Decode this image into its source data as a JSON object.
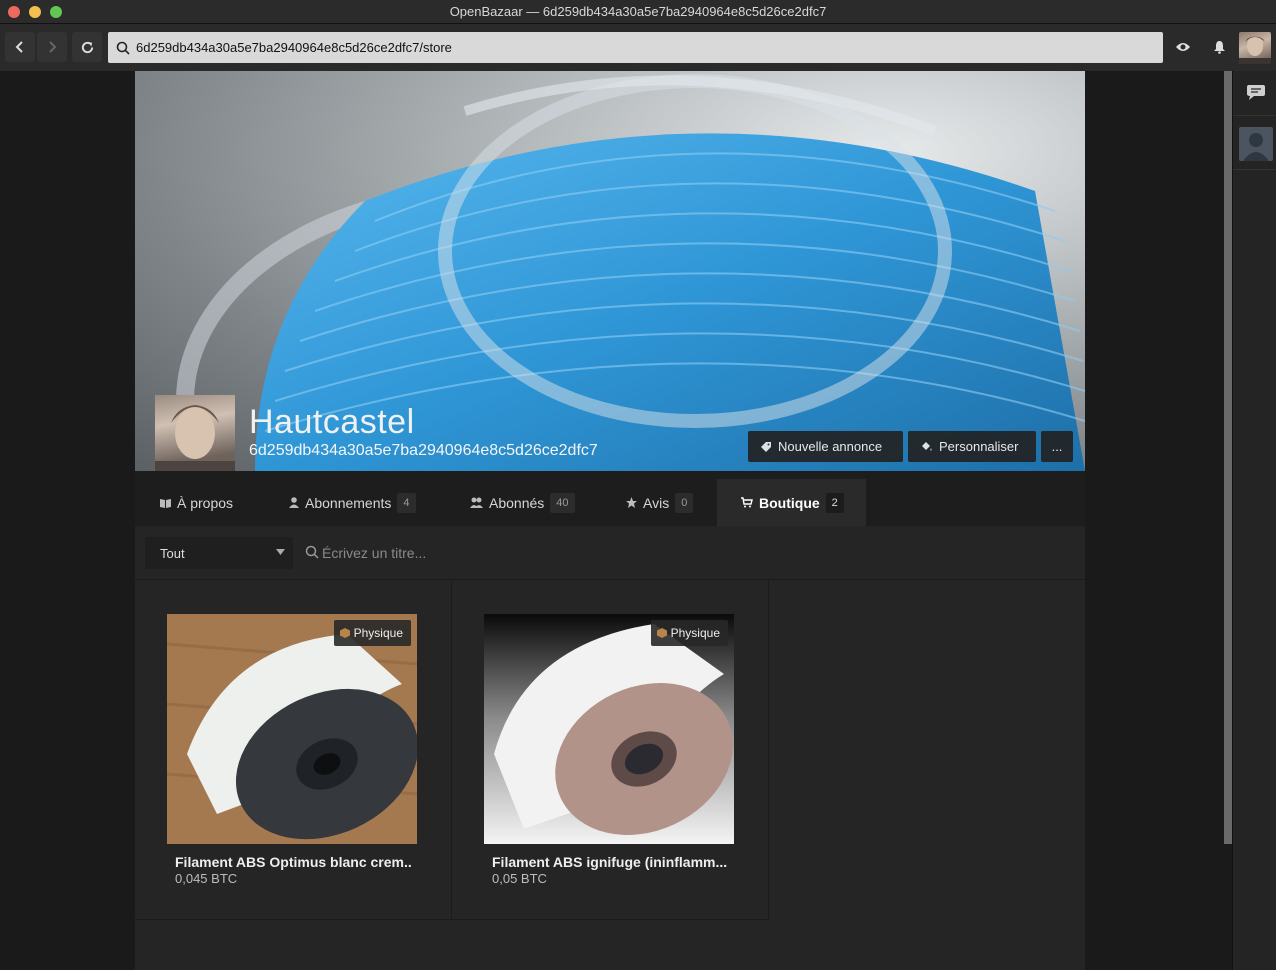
{
  "window": {
    "title": "OpenBazaar — 6d259db434a30a5e7ba2940964e8c5d26ce2dfc7"
  },
  "address": {
    "url": "6d259db434a30a5e7ba2940964e8c5d26ce2dfc7/store"
  },
  "store": {
    "name": "Hautcastel",
    "guid": "6d259db434a30a5e7ba2940964e8c5d26ce2dfc7",
    "buttons": {
      "new_listing": "Nouvelle annonce",
      "customize": "Personnaliser",
      "more": "..."
    }
  },
  "tabs": [
    {
      "label": "À propos",
      "count": ""
    },
    {
      "label": "Abonnements",
      "count": "4"
    },
    {
      "label": "Abonnés",
      "count": "40"
    },
    {
      "label": "Avis",
      "count": "0"
    },
    {
      "label": "Boutique",
      "count": "2"
    }
  ],
  "filter": {
    "selected": "Tout",
    "search_placeholder": "Écrivez un titre..."
  },
  "listings": [
    {
      "title": "Filament ABS Optimus blanc crem..",
      "price": "0,045 BTC",
      "badge": "Physique"
    },
    {
      "title": "Filament ABS ignifuge (ininflamm...",
      "price": "0,05 BTC",
      "badge": "Physique"
    }
  ],
  "colors": {
    "accent": "#2a2a2a",
    "filament_blue": "#3aa0dd"
  }
}
